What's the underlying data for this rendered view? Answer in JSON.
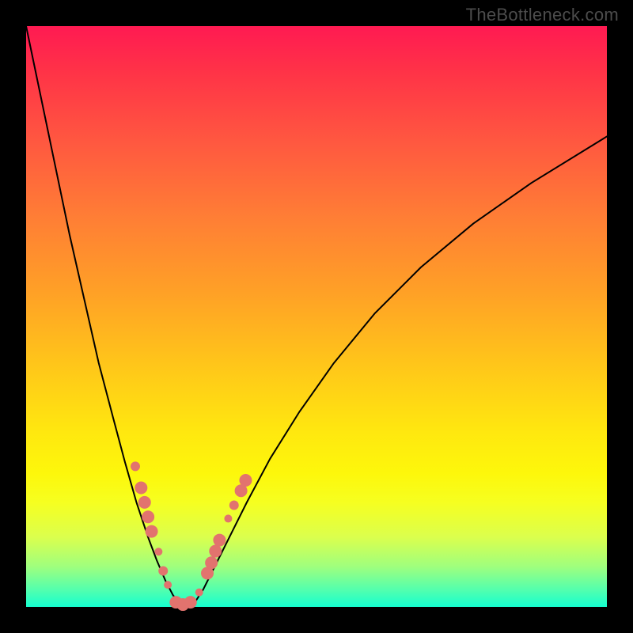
{
  "watermark": "TheBottleneck.com",
  "chart_data": {
    "type": "line",
    "title": "",
    "xlabel": "",
    "ylabel": "",
    "xlim": [
      0,
      100
    ],
    "ylim": [
      0,
      100
    ],
    "legend": false,
    "grid": false,
    "series": [
      {
        "name": "bottleneck-curve",
        "color": "#000000",
        "thickness": 2,
        "x": [
          0.0,
          2.5,
          5.0,
          7.5,
          10.0,
          12.5,
          15.0,
          17.0,
          19.0,
          21.0,
          22.5,
          24.0,
          25.3,
          26.4,
          27.5,
          29.0,
          30.5,
          32.5,
          35.0,
          38.0,
          42.0,
          47.0,
          53.0,
          60.0,
          68.0,
          77.0,
          87.0,
          100.0
        ],
        "y": [
          100.0,
          88.0,
          76.0,
          64.0,
          53.0,
          42.0,
          32.5,
          25.0,
          18.0,
          12.0,
          8.0,
          4.5,
          2.0,
          0.7,
          0.0,
          0.7,
          3.0,
          7.0,
          12.0,
          18.0,
          25.5,
          33.5,
          42.0,
          50.5,
          58.5,
          66.0,
          73.0,
          81.0
        ]
      }
    ],
    "markers": [
      {
        "name": "data-points",
        "color": "#e2736e",
        "points": [
          {
            "x": 18.8,
            "y": 24.2,
            "r": 6
          },
          {
            "x": 19.8,
            "y": 20.5,
            "r": 8
          },
          {
            "x": 20.4,
            "y": 18.0,
            "r": 8
          },
          {
            "x": 21.0,
            "y": 15.5,
            "r": 8
          },
          {
            "x": 21.6,
            "y": 13.0,
            "r": 8
          },
          {
            "x": 22.8,
            "y": 9.5,
            "r": 5
          },
          {
            "x": 23.6,
            "y": 6.2,
            "r": 6
          },
          {
            "x": 24.4,
            "y": 3.8,
            "r": 5
          },
          {
            "x": 25.8,
            "y": 0.8,
            "r": 8
          },
          {
            "x": 27.0,
            "y": 0.4,
            "r": 8
          },
          {
            "x": 28.3,
            "y": 0.8,
            "r": 8
          },
          {
            "x": 29.8,
            "y": 2.5,
            "r": 5
          },
          {
            "x": 31.2,
            "y": 5.8,
            "r": 8
          },
          {
            "x": 31.9,
            "y": 7.6,
            "r": 8
          },
          {
            "x": 32.6,
            "y": 9.6,
            "r": 8
          },
          {
            "x": 33.3,
            "y": 11.5,
            "r": 8
          },
          {
            "x": 34.8,
            "y": 15.2,
            "r": 5
          },
          {
            "x": 35.8,
            "y": 17.5,
            "r": 6
          },
          {
            "x": 37.0,
            "y": 20.0,
            "r": 8
          },
          {
            "x": 37.8,
            "y": 21.8,
            "r": 8
          }
        ]
      }
    ]
  }
}
